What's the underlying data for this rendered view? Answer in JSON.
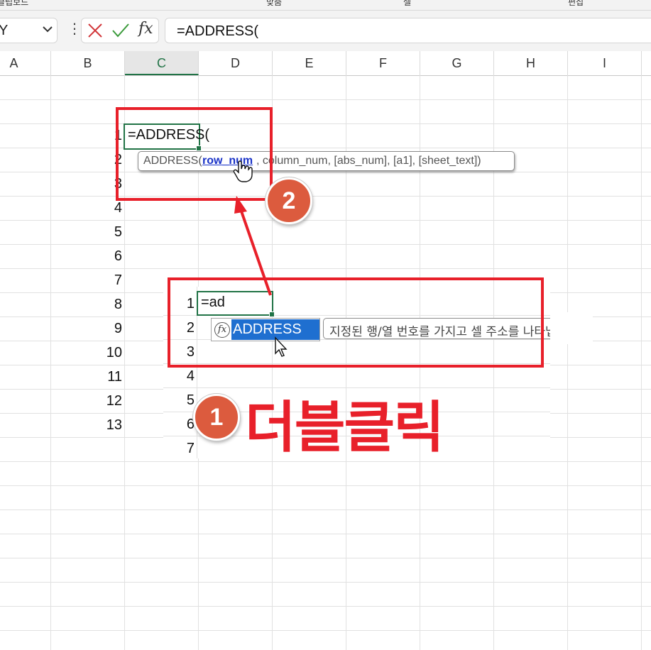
{
  "ribbon_partial": [
    "클립보드",
    "맞춤",
    "셀",
    "편집"
  ],
  "name_box": {
    "value": "Y"
  },
  "formula_bar": {
    "cancel_icon": "close-icon",
    "enter_icon": "check-icon",
    "fx_label": "fx",
    "content": "=ADDRESS("
  },
  "column_headers": [
    "A",
    "B",
    "C",
    "D",
    "E",
    "F",
    "G",
    "H",
    "I"
  ],
  "selected_column": "C",
  "row_numbers": [
    "1",
    "2",
    "3",
    "4",
    "5",
    "6",
    "7",
    "8",
    "9",
    "10",
    "11",
    "12",
    "13"
  ],
  "step2": {
    "cell_text": "=ADDRESS(",
    "tooltip": {
      "prefix": "ADDRESS(",
      "arg_current": "row_num",
      "rest": ", column_num, [abs_num], [a1], [sheet_text])"
    },
    "badge": "2"
  },
  "step1": {
    "inset_rows": [
      "1",
      "2",
      "3",
      "4",
      "5",
      "6",
      "7"
    ],
    "cell_text": "=ad",
    "autocomplete_item": "ADDRESS",
    "autocomplete_desc": "지정된 행/열 번호를 가지고 셀 주소를 나타냅니다.",
    "badge": "1",
    "label": "더블클릭"
  },
  "colors": {
    "annotation_red": "#e8202a",
    "badge_orange": "#dc5b3e",
    "excel_green": "#217346",
    "selection_blue": "#1f6fd0"
  }
}
